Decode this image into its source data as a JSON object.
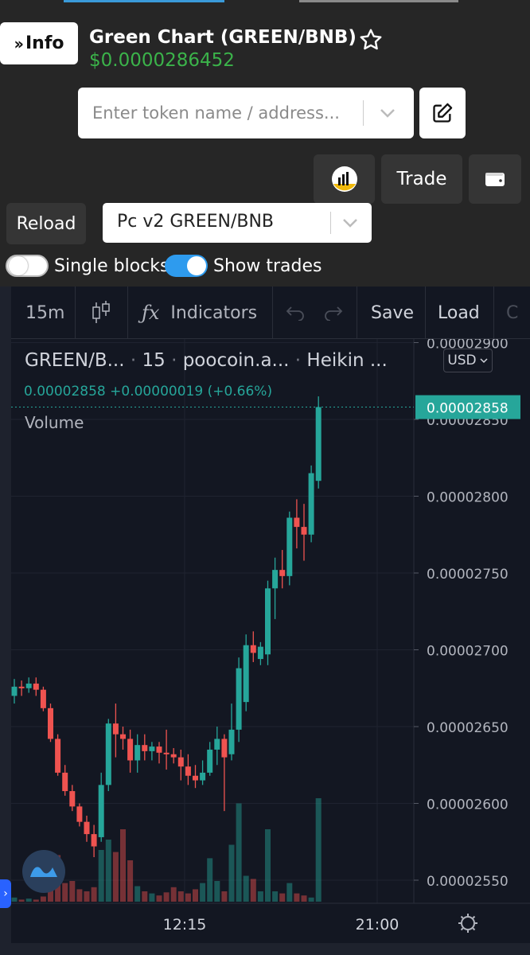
{
  "header": {
    "info_label": "Info",
    "token_title": "Green Chart (GREEN/BNB)",
    "token_price": "$0.0000286452"
  },
  "search": {
    "placeholder": "Enter token name / address..."
  },
  "actions": {
    "trade_label": "Trade",
    "reload_label": "Reload",
    "pair_selected": "Pc v2 GREEN/BNB"
  },
  "toggles": {
    "single_blocks": {
      "label": "Single blocks",
      "on": false
    },
    "show_trades": {
      "label": "Show trades",
      "on": true
    }
  },
  "toolbar": {
    "interval": "15m",
    "indicators_label": "Indicators",
    "save_label": "Save",
    "load_label": "Load",
    "cut_label": "C"
  },
  "legend": {
    "symbol": "GREEN/B...",
    "interval": "15",
    "source": "poocoin.a...",
    "chart_style": "Heikin ...",
    "last_value": "0.00002858",
    "change": "+0.00000019",
    "change_pct": "(+0.66%)",
    "volume_label": "Volume",
    "currency": "USD"
  },
  "colors": {
    "up": "#26a69a",
    "down": "#ef5350",
    "price_green": "#3bb34a",
    "toggle_on": "#2e9bee"
  },
  "chart_data": {
    "type": "candlestick",
    "y_tick_labels": [
      "0.00002900",
      "0.00002850",
      "0.00002800",
      "0.00002750",
      "0.00002700",
      "0.00002650",
      "0.00002600",
      "0.00002550"
    ],
    "y_ticks": [
      2.9e-05,
      2.85e-05,
      2.8e-05,
      2.75e-05,
      2.7e-05,
      2.65e-05,
      2.6e-05,
      2.55e-05
    ],
    "ylim": [
      2.535e-05,
      2.91e-05
    ],
    "x_tick_labels": [
      "12:15",
      "21:00"
    ],
    "last_price_label": "0.00002858",
    "candles": [
      {
        "o": 2.67e-05,
        "h": 2.681e-05,
        "l": 2.665e-05,
        "c": 2.676e-05
      },
      {
        "o": 2.676e-05,
        "h": 2.68e-05,
        "l": 2.67e-05,
        "c": 2.675e-05
      },
      {
        "o": 2.675e-05,
        "h": 2.682e-05,
        "l": 2.672e-05,
        "c": 2.678e-05
      },
      {
        "o": 2.678e-05,
        "h": 2.682e-05,
        "l": 2.67e-05,
        "c": 2.674e-05
      },
      {
        "o": 2.674e-05,
        "h": 2.676e-05,
        "l": 2.66e-05,
        "c": 2.662e-05
      },
      {
        "o": 2.662e-05,
        "h": 2.665e-05,
        "l": 2.64e-05,
        "c": 2.642e-05
      },
      {
        "o": 2.642e-05,
        "h": 2.645e-05,
        "l": 2.618e-05,
        "c": 2.62e-05
      },
      {
        "o": 2.62e-05,
        "h": 2.625e-05,
        "l": 2.605e-05,
        "c": 2.608e-05
      },
      {
        "o": 2.608e-05,
        "h": 2.612e-05,
        "l": 2.595e-05,
        "c": 2.598e-05
      },
      {
        "o": 2.598e-05,
        "h": 2.6e-05,
        "l": 2.585e-05,
        "c": 2.588e-05
      },
      {
        "o": 2.588e-05,
        "h": 2.592e-05,
        "l": 2.575e-05,
        "c": 2.58e-05
      },
      {
        "o": 2.58e-05,
        "h": 2.586e-05,
        "l": 2.565e-05,
        "c": 2.572e-05
      },
      {
        "o": 2.578e-05,
        "h": 2.62e-05,
        "l": 2.575e-05,
        "c": 2.612e-05
      },
      {
        "o": 2.612e-05,
        "h": 2.655e-05,
        "l": 2.608e-05,
        "c": 2.652e-05
      },
      {
        "o": 2.652e-05,
        "h": 2.665e-05,
        "l": 2.63e-05,
        "c": 2.645e-05
      },
      {
        "o": 2.645e-05,
        "h": 2.65e-05,
        "l": 2.635e-05,
        "c": 2.642e-05
      },
      {
        "o": 2.642e-05,
        "h": 2.648e-05,
        "l": 2.62e-05,
        "c": 2.628e-05
      },
      {
        "o": 2.628e-05,
        "h": 2.645e-05,
        "l": 2.62e-05,
        "c": 2.638e-05
      },
      {
        "o": 2.638e-05,
        "h": 2.645e-05,
        "l": 2.628e-05,
        "c": 2.634e-05
      },
      {
        "o": 2.634e-05,
        "h": 2.64e-05,
        "l": 2.628e-05,
        "c": 2.637e-05
      },
      {
        "o": 2.637e-05,
        "h": 2.64e-05,
        "l": 2.626e-05,
        "c": 2.633e-05
      },
      {
        "o": 2.633e-05,
        "h": 2.648e-05,
        "l": 2.622e-05,
        "c": 2.632e-05
      },
      {
        "o": 2.632e-05,
        "h": 2.636e-05,
        "l": 2.626e-05,
        "c": 2.63e-05
      },
      {
        "o": 2.63e-05,
        "h": 2.635e-05,
        "l": 2.615e-05,
        "c": 2.624e-05
      },
      {
        "o": 2.624e-05,
        "h": 2.632e-05,
        "l": 2.612e-05,
        "c": 2.618e-05
      },
      {
        "o": 2.618e-05,
        "h": 2.625e-05,
        "l": 2.61e-05,
        "c": 2.615e-05
      },
      {
        "o": 2.615e-05,
        "h": 2.628e-05,
        "l": 2.612e-05,
        "c": 2.62e-05
      },
      {
        "o": 2.62e-05,
        "h": 2.64e-05,
        "l": 2.618e-05,
        "c": 2.635e-05
      },
      {
        "o": 2.635e-05,
        "h": 2.65e-05,
        "l": 2.625e-05,
        "c": 2.642e-05
      },
      {
        "o": 2.642e-05,
        "h": 2.645e-05,
        "l": 2.595e-05,
        "c": 2.63e-05
      },
      {
        "o": 2.632e-05,
        "h": 2.665e-05,
        "l": 2.628e-05,
        "c": 2.648e-05
      },
      {
        "o": 2.648e-05,
        "h": 2.695e-05,
        "l": 2.64e-05,
        "c": 2.688e-05
      },
      {
        "o": 2.666e-05,
        "h": 2.71e-05,
        "l": 2.66e-05,
        "c": 2.703e-05
      },
      {
        "o": 2.703e-05,
        "h": 2.712e-05,
        "l": 2.692e-05,
        "c": 2.698e-05
      },
      {
        "o": 2.694e-05,
        "h": 2.705e-05,
        "l": 2.69e-05,
        "c": 2.702e-05
      },
      {
        "o": 2.697e-05,
        "h": 2.745e-05,
        "l": 2.69e-05,
        "c": 2.74e-05
      },
      {
        "o": 2.74e-05,
        "h": 2.76e-05,
        "l": 2.72e-05,
        "c": 2.752e-05
      },
      {
        "o": 2.752e-05,
        "h": 2.765e-05,
        "l": 2.74e-05,
        "c": 2.748e-05
      },
      {
        "o": 2.748e-05,
        "h": 2.79e-05,
        "l": 2.742e-05,
        "c": 2.786e-05
      },
      {
        "o": 2.786e-05,
        "h": 2.798e-05,
        "l": 2.766e-05,
        "c": 2.78e-05
      },
      {
        "o": 2.78e-05,
        "h": 2.795e-05,
        "l": 2.758e-05,
        "c": 2.775e-05
      },
      {
        "o": 2.775e-05,
        "h": 2.82e-05,
        "l": 2.77e-05,
        "c": 2.815e-05
      },
      {
        "o": 2.81e-05,
        "h": 2.865e-05,
        "l": 2.805e-05,
        "c": 2.858e-05
      }
    ],
    "volumes": [
      4,
      2,
      3,
      2,
      5,
      28,
      45,
      18,
      20,
      12,
      10,
      14,
      50,
      60,
      48,
      70,
      40,
      15,
      10,
      8,
      6,
      9,
      14,
      10,
      8,
      12,
      18,
      42,
      20,
      10,
      55,
      95,
      25,
      22,
      10,
      70,
      10,
      8,
      18,
      8,
      6,
      4,
      100
    ]
  }
}
